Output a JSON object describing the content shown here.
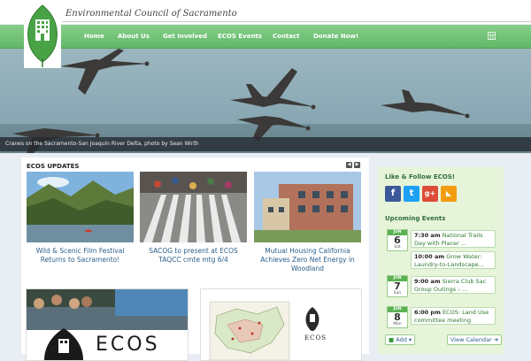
{
  "site": {
    "title": "Environmental Council of Sacramento"
  },
  "nav": {
    "items": [
      {
        "label": "Home"
      },
      {
        "label": "About Us"
      },
      {
        "label": "Get Involved"
      },
      {
        "label": "ECOS Events"
      },
      {
        "label": "Contact"
      },
      {
        "label": "Donate Now!"
      }
    ],
    "extra_icon": "grid-icon"
  },
  "hero": {
    "caption": "Cranes on the Sacramento-San Joaquin River Delta, photo by Sean Wirth"
  },
  "updates": {
    "title": "ECOS UPDATES",
    "cards": [
      {
        "caption": "Wild & Scenic Film Festival Returns to Sacramento!"
      },
      {
        "caption": "SACOG to present at ECOS TAQCC cmte mtg 6/4"
      },
      {
        "caption": "Mutual Housing California Achieves Zero Net Energy in Woodland"
      }
    ],
    "tile_text": "ECOS",
    "map_label": "ECOS"
  },
  "sidebar": {
    "follow_title": "Like & Follow ECOS!",
    "social": [
      {
        "icon": "facebook-icon",
        "glyph": "f",
        "color": "#3b5998"
      },
      {
        "icon": "twitter-icon",
        "glyph": "t",
        "color": "#1da1f2"
      },
      {
        "icon": "google-plus-icon",
        "glyph": "g+",
        "color": "#dd4b39"
      },
      {
        "icon": "rss-icon",
        "glyph": "◣",
        "color": "#f39c12"
      }
    ],
    "events_title": "Upcoming Events",
    "days": [
      {
        "month": "JUN",
        "day": "6",
        "dow": "Sat"
      },
      {
        "month": "JUN",
        "day": "7",
        "dow": "Sun"
      },
      {
        "month": "JUN",
        "day": "8",
        "dow": "Mon"
      }
    ],
    "events": [
      {
        "time": "7:30 am",
        "title": "National Trails Day with Placer ..."
      },
      {
        "time": "10:00 am",
        "title": "Grow Water: Laundry-to-Landscape..."
      },
      {
        "time": "9:00 am",
        "title": "Sierra Club Sac Group Outings – ..."
      },
      {
        "time": "6:00 pm",
        "title": "ECOS: Land Use committee meeting"
      }
    ],
    "add_label": "Add",
    "view_calendar_label": "View Calendar"
  }
}
